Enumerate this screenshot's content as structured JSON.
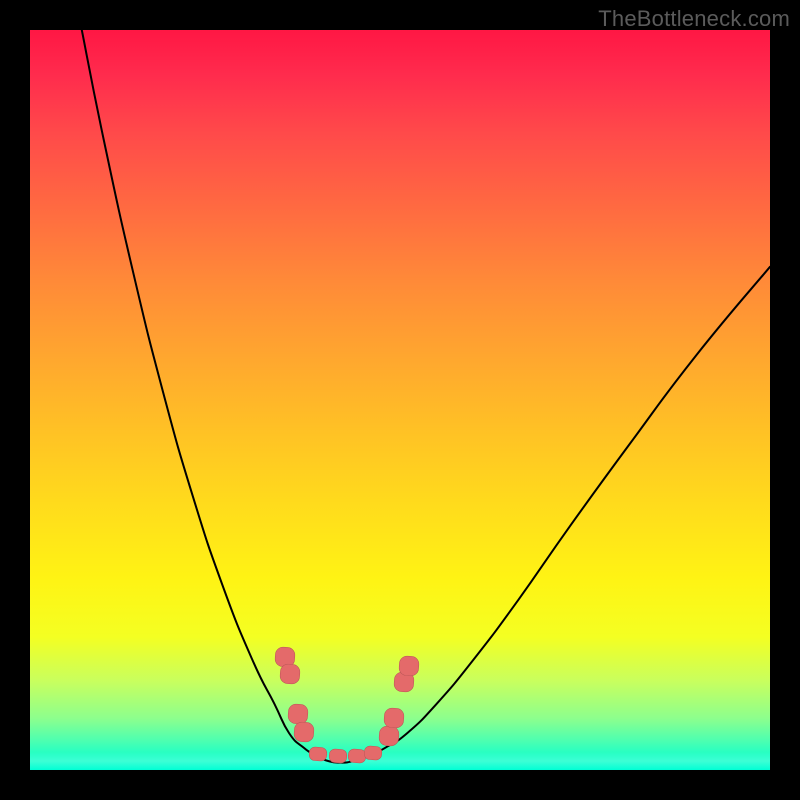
{
  "attribution": "TheBottleneck.com",
  "colors": {
    "gradient_top": "#ff1744",
    "gradient_bottom": "#00ffd5",
    "curve": "#000000",
    "marker": "#e46a6a",
    "frame_bg": "#000000"
  },
  "chart_data": {
    "type": "line",
    "title": "",
    "xlabel": "",
    "ylabel": "",
    "xlim": [
      0,
      100
    ],
    "ylim": [
      0,
      100
    ],
    "grid": false,
    "legend": false,
    "series": [
      {
        "name": "left-curve",
        "x": [
          7,
          10,
          14,
          18,
          22,
          26,
          30,
          33,
          35,
          37,
          38.5
        ],
        "y": [
          100,
          85,
          67,
          51,
          37,
          25,
          15,
          9,
          5,
          3,
          2
        ]
      },
      {
        "name": "right-curve",
        "x": [
          46,
          48,
          51,
          55,
          60,
          66,
          73,
          81,
          90,
          100
        ],
        "y": [
          2,
          3,
          5,
          9,
          15,
          23,
          33,
          44,
          56,
          68
        ]
      },
      {
        "name": "valley-bottom",
        "x": [
          38.5,
          40,
          42,
          44,
          46
        ],
        "y": [
          2,
          1.3,
          1,
          1.3,
          2
        ]
      }
    ],
    "markers": [
      {
        "x": 34.5,
        "y": 15.3
      },
      {
        "x": 35.1,
        "y": 13.0
      },
      {
        "x": 36.2,
        "y": 7.6
      },
      {
        "x": 37.0,
        "y": 5.1
      },
      {
        "x": 38.9,
        "y": 2.2,
        "shape": "bar"
      },
      {
        "x": 41.6,
        "y": 1.9,
        "shape": "bar"
      },
      {
        "x": 44.2,
        "y": 1.9,
        "shape": "bar"
      },
      {
        "x": 46.4,
        "y": 2.3,
        "shape": "bar"
      },
      {
        "x": 48.5,
        "y": 4.6
      },
      {
        "x": 49.2,
        "y": 7.0
      },
      {
        "x": 50.5,
        "y": 11.9
      },
      {
        "x": 51.2,
        "y": 14.1
      }
    ]
  }
}
